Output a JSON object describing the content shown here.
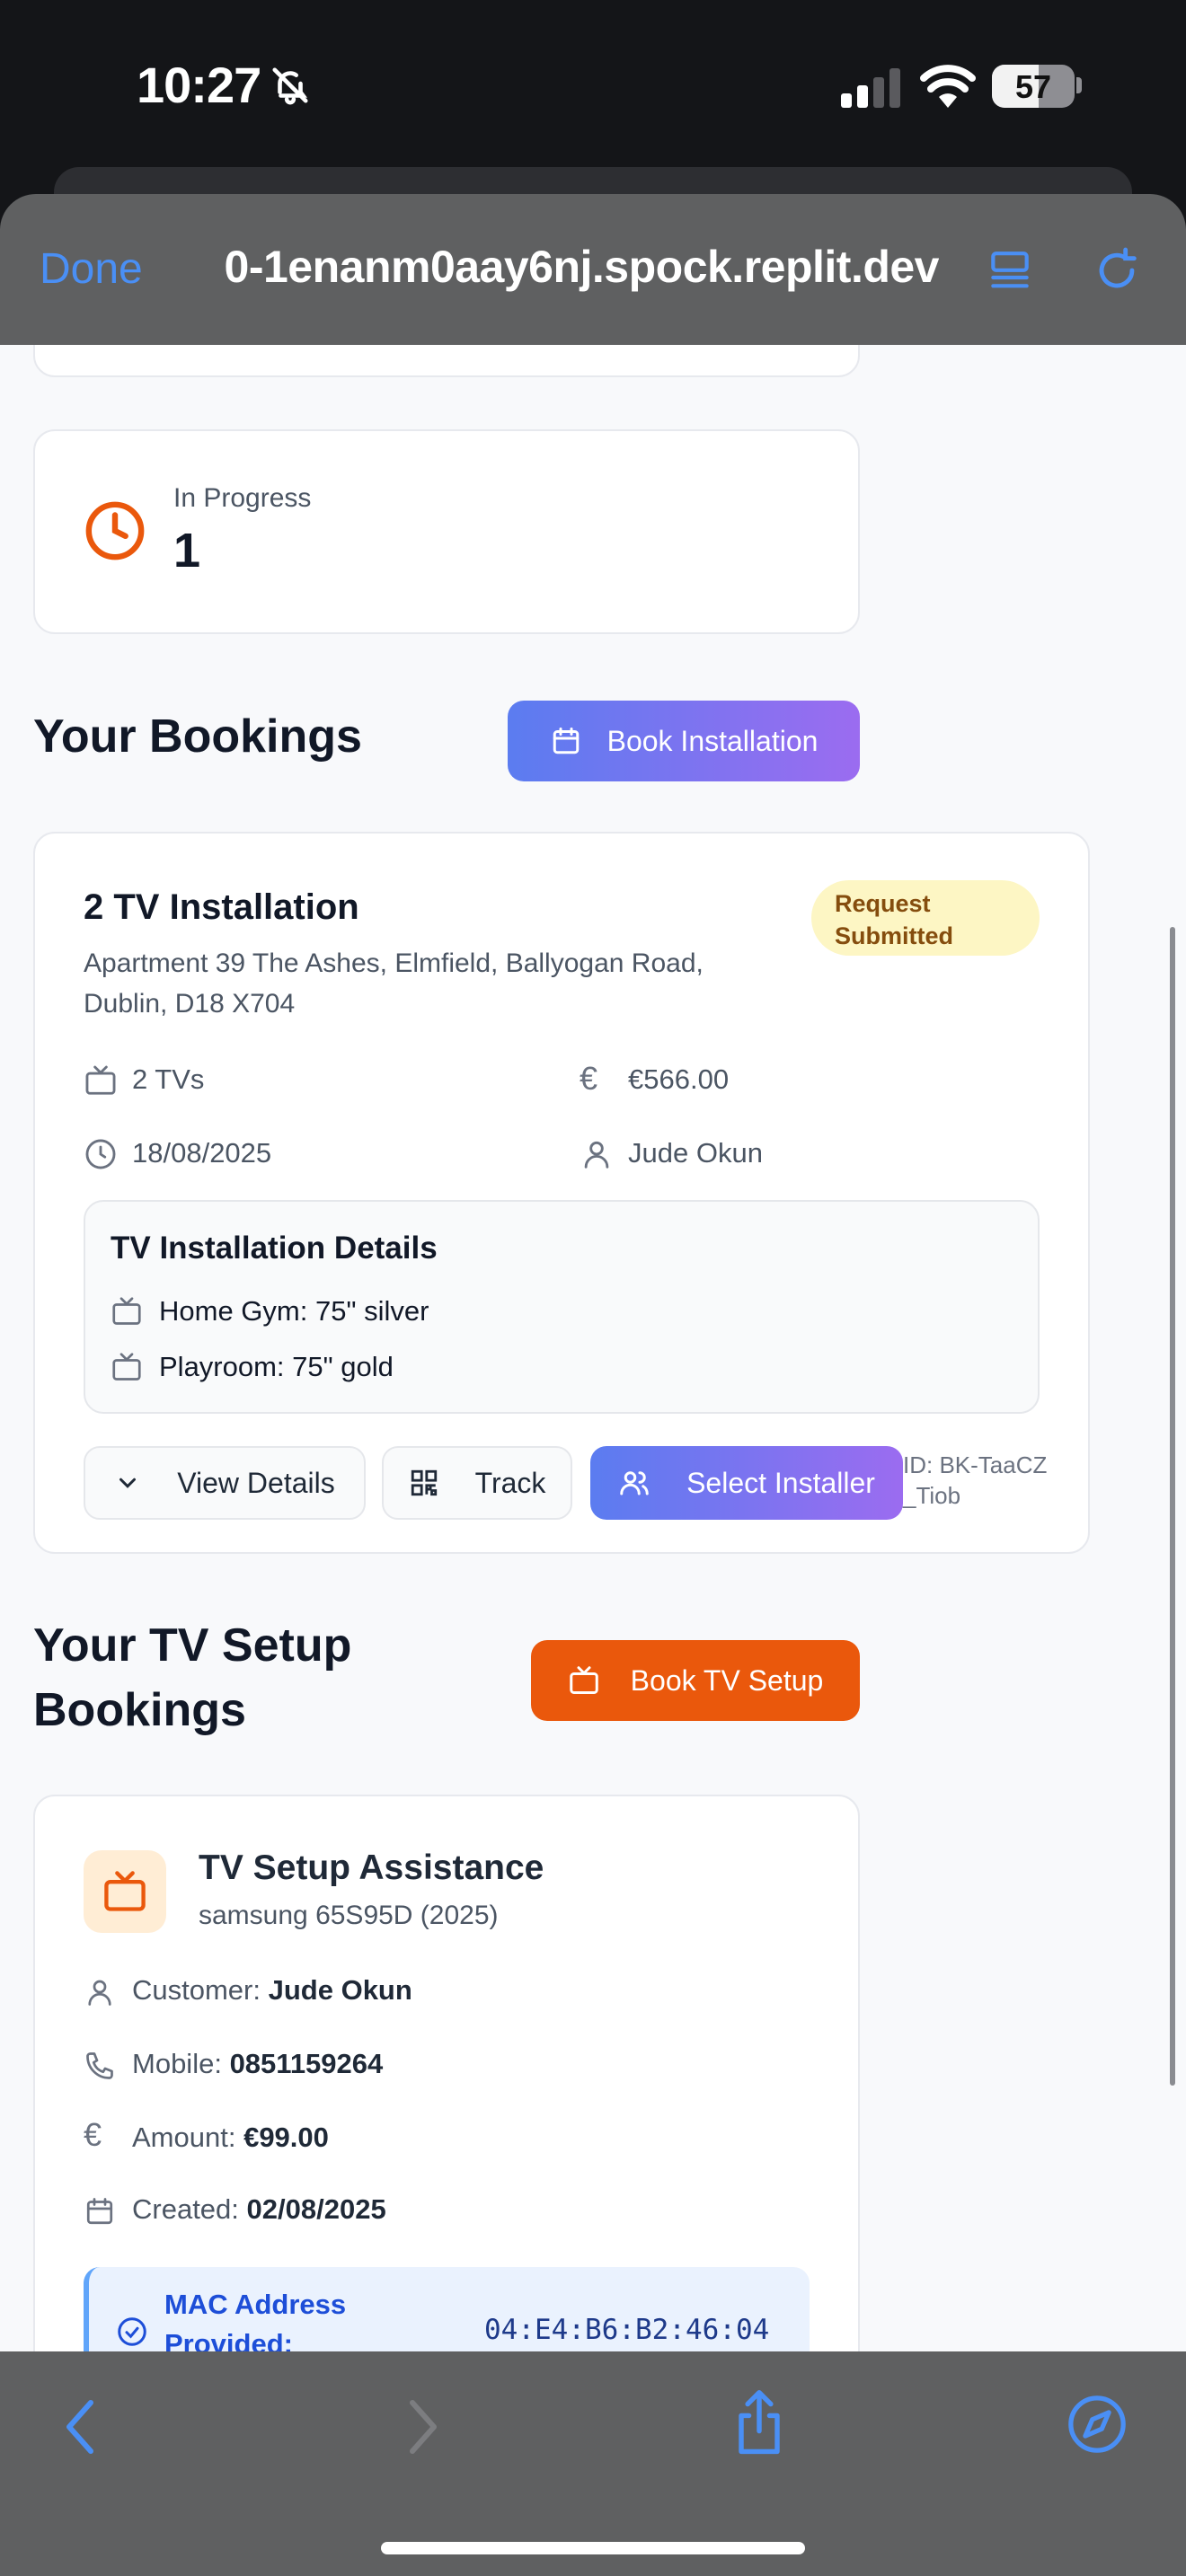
{
  "status_bar": {
    "time": "10:27",
    "battery": "57",
    "battery_level": 0.57
  },
  "browser": {
    "done_label": "Done",
    "url": "0-1enanm0aay6nj.spock.replit.dev"
  },
  "stats": {
    "in_progress_label": "In Progress",
    "in_progress_value": "1"
  },
  "bookings": {
    "heading": "Your Bookings",
    "book_button": "Book Installation",
    "card": {
      "title": "2 TV Installation",
      "address": "Apartment 39 The Ashes, Elmfield, Ballyogan Road, Dublin, D18 X704",
      "status": "Request Submitted",
      "tvs": "2 TVs",
      "price": "€566.00",
      "date": "18/08/2025",
      "customer": "Jude Okun",
      "details_heading": "TV Installation Details",
      "details": [
        "Home Gym: 75\" silver",
        "Playroom: 75\" gold"
      ],
      "view_details": "View Details",
      "track": "Track",
      "select_installer": "Select Installer",
      "booking_id": "ID: BK-TaaCZ_Tiob"
    }
  },
  "tv_setup": {
    "heading": "Your TV Setup Bookings",
    "book_button": "Book TV Setup",
    "card": {
      "title": "TV Setup Assistance",
      "model": "samsung 65S95D (2025)",
      "customer_label": "Customer:",
      "customer_value": "Jude Okun",
      "mobile_label": "Mobile:",
      "mobile_value": "0851159264",
      "amount_label": "Amount:",
      "amount_value": "€99.00",
      "created_label": "Created:",
      "created_value": "02/08/2025",
      "mac_label": "MAC Address Provided:",
      "mac_value": "04:E4:B6:B2:46:04"
    }
  },
  "colors": {
    "accent_blue": "#4a8ff5",
    "orange": "#ea580c",
    "gradient_start": "#5b7cf0",
    "gradient_end": "#9b6cf0",
    "badge_bg": "#fdf6c4",
    "badge_text": "#854d0e"
  }
}
